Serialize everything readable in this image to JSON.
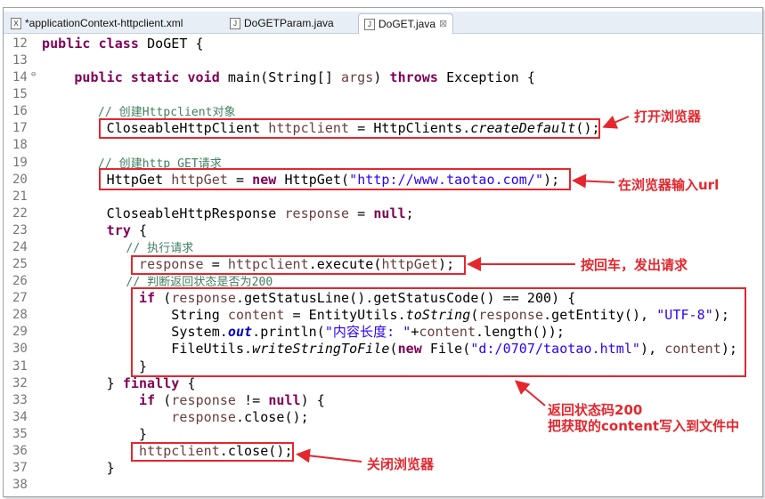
{
  "tabs": [
    {
      "label": "*applicationContext-httpclient.xml",
      "icon": "xml-file-icon",
      "glyph": "X"
    },
    {
      "label": "DoGETParam.java",
      "icon": "java-file-icon",
      "glyph": "J"
    },
    {
      "label": "DoGET.java",
      "icon": "java-file-icon",
      "glyph": "J",
      "active": true,
      "close": "⊠"
    }
  ],
  "lines": [
    {
      "n": "12",
      "tk": [
        [
          "public class ",
          "kw"
        ],
        [
          "DoGET {",
          ""
        ]
      ]
    },
    {
      "n": "13",
      "tk": []
    },
    {
      "n": "14",
      "fold": true,
      "tk": [
        [
          "    public static void ",
          "kw"
        ],
        [
          "main(String[] ",
          ""
        ],
        [
          "args",
          "var"
        ],
        [
          ") ",
          ""
        ],
        [
          "throws ",
          "kw"
        ],
        [
          "Exception {",
          ""
        ]
      ]
    },
    {
      "n": "15",
      "tk": []
    },
    {
      "n": "16",
      "tk": [
        [
          "        // 创建Httpclient对象",
          "cm"
        ]
      ]
    },
    {
      "n": "17",
      "tk": [
        [
          "        CloseableHttpClient ",
          ""
        ],
        [
          "httpclient",
          "var"
        ],
        [
          " = HttpClients.",
          ""
        ],
        [
          "createDefault",
          "it"
        ],
        [
          "();",
          ""
        ]
      ]
    },
    {
      "n": "18",
      "tk": []
    },
    {
      "n": "19",
      "tk": [
        [
          "        // 创建http GET请求",
          "cm"
        ]
      ]
    },
    {
      "n": "20",
      "tk": [
        [
          "        HttpGet ",
          ""
        ],
        [
          "httpGet",
          "var"
        ],
        [
          " = ",
          ""
        ],
        [
          "new ",
          "kw"
        ],
        [
          "HttpGet(",
          ""
        ],
        [
          "\"http://www.taotao.com/\"",
          "str"
        ],
        [
          ");",
          ""
        ]
      ]
    },
    {
      "n": "21",
      "tk": []
    },
    {
      "n": "22",
      "tk": [
        [
          "        CloseableHttpResponse ",
          ""
        ],
        [
          "response",
          "var"
        ],
        [
          " = ",
          ""
        ],
        [
          "null",
          "kw"
        ],
        [
          ";",
          ""
        ]
      ]
    },
    {
      "n": "23",
      "tk": [
        [
          "        ",
          ""
        ],
        [
          "try",
          "kw"
        ],
        [
          " {",
          ""
        ]
      ]
    },
    {
      "n": "24",
      "tk": [
        [
          "            // 执行请求",
          "cm"
        ]
      ]
    },
    {
      "n": "25",
      "tk": [
        [
          "            ",
          ""
        ],
        [
          "response",
          "var"
        ],
        [
          " = ",
          ""
        ],
        [
          "httpclient",
          "var"
        ],
        [
          ".execute(",
          ""
        ],
        [
          "httpGet",
          "var"
        ],
        [
          ");",
          ""
        ]
      ]
    },
    {
      "n": "26",
      "tk": [
        [
          "            // 判断返回状态是否为200",
          "cm"
        ]
      ]
    },
    {
      "n": "27",
      "tk": [
        [
          "            ",
          ""
        ],
        [
          "if",
          "kw"
        ],
        [
          " (",
          ""
        ],
        [
          "response",
          "var"
        ],
        [
          ".getStatusLine().getStatusCode() == 200) {",
          ""
        ]
      ]
    },
    {
      "n": "28",
      "tk": [
        [
          "                String ",
          ""
        ],
        [
          "content",
          "var"
        ],
        [
          " = EntityUtils.",
          ""
        ],
        [
          "toString",
          "it"
        ],
        [
          "(",
          ""
        ],
        [
          "response",
          "var"
        ],
        [
          ".getEntity(), ",
          ""
        ],
        [
          "\"UTF-8\"",
          "str"
        ],
        [
          ");",
          ""
        ]
      ]
    },
    {
      "n": "29",
      "tk": [
        [
          "                System.",
          ""
        ],
        [
          "out",
          "fld"
        ],
        [
          ".println(",
          ""
        ],
        [
          "\"内容长度: \"",
          "str"
        ],
        [
          "+",
          ""
        ],
        [
          "content",
          "var"
        ],
        [
          ".length());",
          ""
        ]
      ]
    },
    {
      "n": "30",
      "tk": [
        [
          "                FileUtils.",
          ""
        ],
        [
          "writeStringToFile",
          "it"
        ],
        [
          "(",
          ""
        ],
        [
          "new ",
          "kw"
        ],
        [
          "File(",
          ""
        ],
        [
          "\"d:/0707/taotao.html\"",
          "str"
        ],
        [
          "), ",
          ""
        ],
        [
          "content",
          "var"
        ],
        [
          ");",
          ""
        ]
      ]
    },
    {
      "n": "31",
      "tk": [
        [
          "            }",
          ""
        ]
      ]
    },
    {
      "n": "32",
      "tk": [
        [
          "        } ",
          ""
        ],
        [
          "finally",
          "kw"
        ],
        [
          " {",
          ""
        ]
      ]
    },
    {
      "n": "33",
      "tk": [
        [
          "            ",
          ""
        ],
        [
          "if",
          "kw"
        ],
        [
          " (",
          ""
        ],
        [
          "response",
          "var"
        ],
        [
          " != ",
          ""
        ],
        [
          "null",
          "kw"
        ],
        [
          ") {",
          ""
        ]
      ]
    },
    {
      "n": "34",
      "tk": [
        [
          "                ",
          ""
        ],
        [
          "response",
          "var"
        ],
        [
          ".close();",
          ""
        ]
      ]
    },
    {
      "n": "35",
      "tk": [
        [
          "            }",
          ""
        ]
      ]
    },
    {
      "n": "36",
      "tk": [
        [
          "            ",
          ""
        ],
        [
          "httpclient",
          "var"
        ],
        [
          ".close();",
          ""
        ]
      ]
    },
    {
      "n": "37",
      "tk": [
        [
          "        }",
          ""
        ]
      ]
    },
    {
      "n": "38",
      "tk": []
    }
  ],
  "annotations": {
    "open_browser": "打开浏览器",
    "enter_url": "在浏览器输入url",
    "press_enter": "按回车，发出请求",
    "status_200": "返回状态码200",
    "write_content": "把获取的content写入到文件中",
    "close_browser": "关闭浏览器"
  },
  "colors": {
    "annotation": "#e5262d",
    "keyword": "#7f0055",
    "comment": "#3f7f5f",
    "string": "#2a00ff"
  }
}
